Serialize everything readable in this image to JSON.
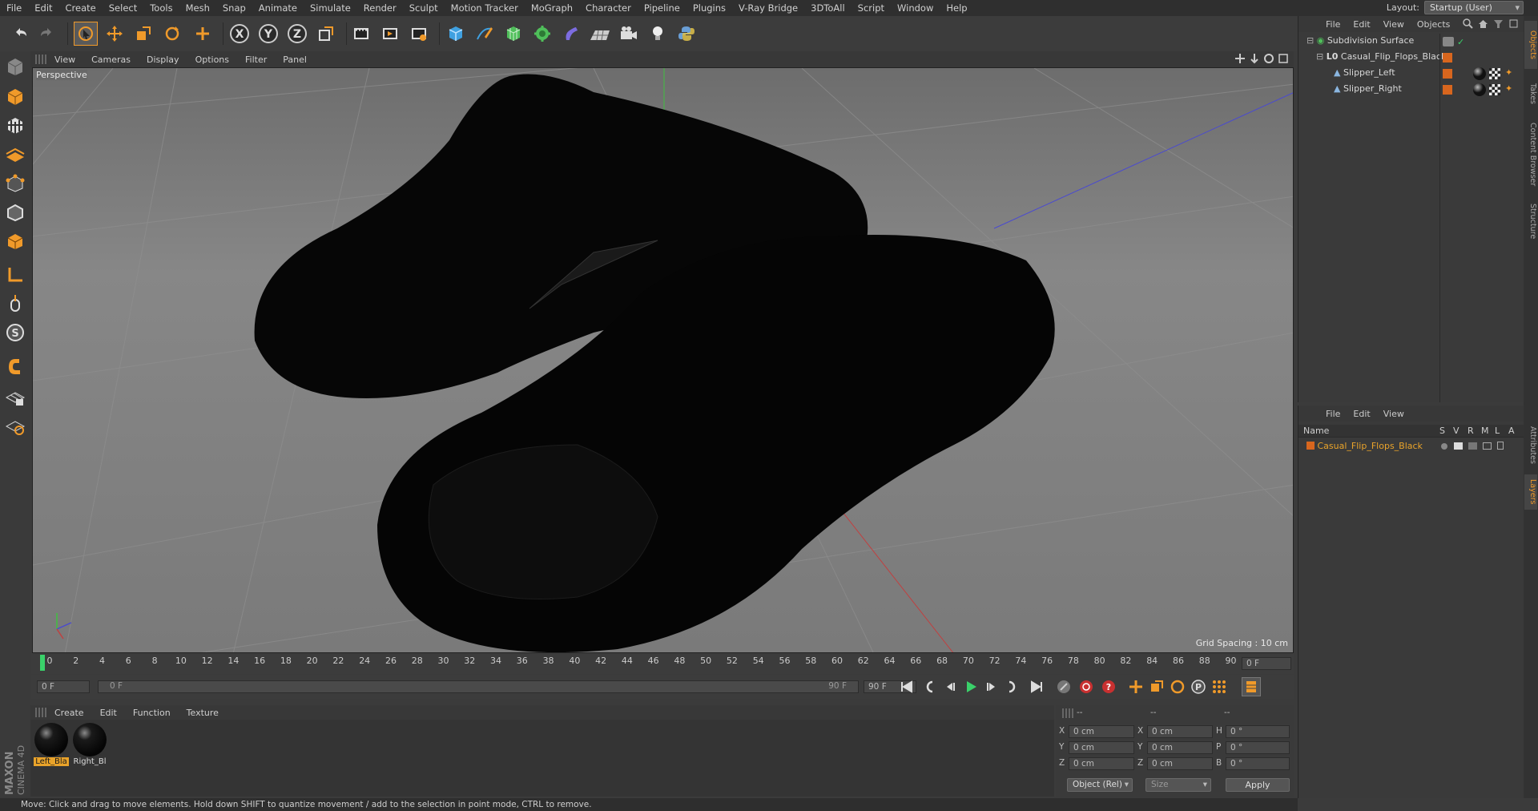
{
  "menubar": {
    "items": [
      "File",
      "Edit",
      "Create",
      "Select",
      "Tools",
      "Mesh",
      "Snap",
      "Animate",
      "Simulate",
      "Render",
      "Sculpt",
      "Motion Tracker",
      "MoGraph",
      "Character",
      "Pipeline",
      "Plugins",
      "V-Ray Bridge",
      "3DToAll",
      "Script",
      "Window",
      "Help"
    ],
    "layout_label": "Layout:",
    "layout_value": "Startup (User)"
  },
  "viewport": {
    "menu": [
      "View",
      "Cameras",
      "Display",
      "Options",
      "Filter",
      "Panel"
    ],
    "label": "Perspective",
    "grid_spacing": "Grid Spacing : 10 cm"
  },
  "timeline": {
    "ticks": [
      "0",
      "2",
      "4",
      "6",
      "8",
      "10",
      "12",
      "14",
      "16",
      "18",
      "20",
      "22",
      "24",
      "26",
      "28",
      "30",
      "32",
      "34",
      "36",
      "38",
      "40",
      "42",
      "44",
      "46",
      "48",
      "50",
      "52",
      "54",
      "56",
      "58",
      "60",
      "62",
      "64",
      "66",
      "68",
      "70",
      "72",
      "74",
      "76",
      "78",
      "80",
      "82",
      "84",
      "86",
      "88",
      "90"
    ],
    "current_frame_right": "0 F",
    "start_frame": "0 F",
    "range_start": "0 F",
    "range_end": "90 F",
    "end_frame": "90 F"
  },
  "materials": {
    "menu": [
      "Create",
      "Edit",
      "Function",
      "Texture"
    ],
    "items": [
      "Left_Bla",
      "Right_Bl"
    ]
  },
  "coords": {
    "rows": [
      {
        "a": "X",
        "av": "0 cm",
        "b": "X",
        "bv": "0 cm",
        "c": "H",
        "cv": "0 °"
      },
      {
        "a": "Y",
        "av": "0 cm",
        "b": "Y",
        "bv": "0 cm",
        "c": "P",
        "cv": "0 °"
      },
      {
        "a": "Z",
        "av": "0 cm",
        "b": "Z",
        "bv": "0 cm",
        "c": "B",
        "cv": "0 °"
      }
    ],
    "mode": "Object (Rel)",
    "size": "Size",
    "apply": "Apply",
    "dashes": "--"
  },
  "object_manager": {
    "menu": [
      "File",
      "Edit",
      "View",
      "Objects"
    ],
    "objects": [
      "Subdivision Surface",
      "Casual_Flip_Flops_Black",
      "Slipper_Left",
      "Slipper_Right"
    ]
  },
  "layer_manager": {
    "menu": [
      "File",
      "Edit",
      "View"
    ],
    "columns": {
      "name": "Name",
      "s": "S",
      "v": "V",
      "r": "R",
      "m": "M",
      "l": "L",
      "a": "A"
    },
    "layers": [
      "Casual_Flip_Flops_Black"
    ]
  },
  "right_tabs": [
    "Objects",
    "Takes",
    "Content Browser",
    "Structure",
    "Attributes",
    "Layers"
  ],
  "brand": {
    "maxon": "MAXON",
    "cinema": "CINEMA 4D"
  },
  "status": "Move: Click and drag to move elements. Hold down SHIFT to quantize movement / add to the selection in point mode, CTRL to remove.",
  "colors": {
    "accent": "#f09a2a",
    "selected_layer": "#e9a32a"
  }
}
